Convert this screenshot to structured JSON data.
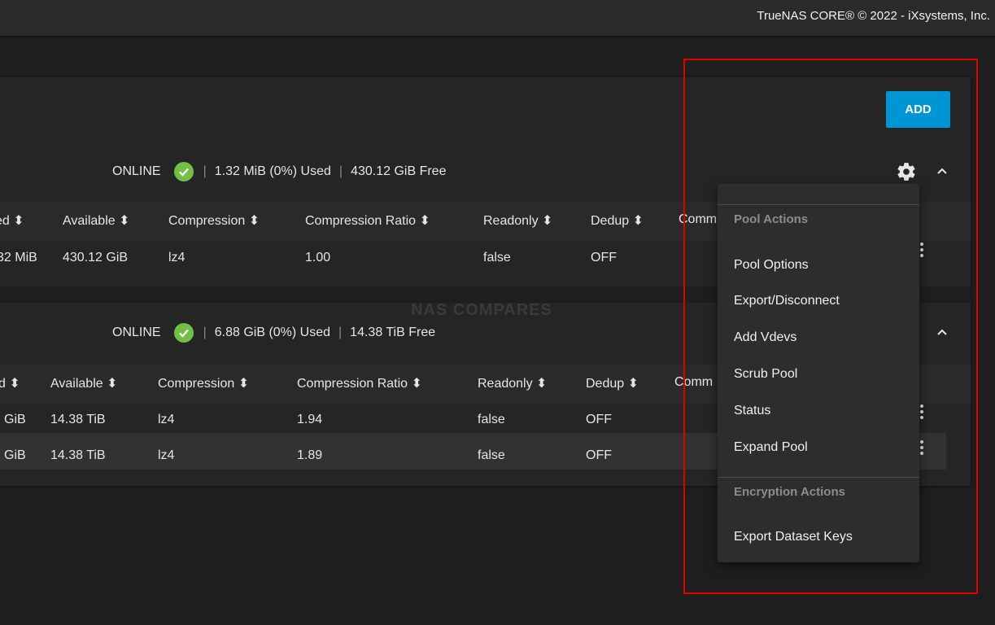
{
  "header": {
    "copyright": "TrueNAS CORE® © 2022 - iXsystems, Inc."
  },
  "toolbar": {
    "add_label": "ADD"
  },
  "watermark": "NAS COMPARES",
  "pools": [
    {
      "status": "ONLINE",
      "used": "1.32 MiB (0%) Used",
      "free": "430.12 GiB Free",
      "columns": [
        "ed ⬍",
        "Available ⬍",
        "Compression ⬍",
        "Compression Ratio ⬍",
        "Readonly ⬍",
        "Dedup ⬍",
        "Comm"
      ],
      "rows": [
        [
          "32 MiB",
          "430.12 GiB",
          "lz4",
          "1.00",
          "false",
          "OFF"
        ]
      ]
    },
    {
      "status": "ONLINE",
      "used": "6.88 GiB (0%) Used",
      "free": "14.38 TiB Free",
      "columns": [
        "d ⬍",
        "Available ⬍",
        "Compression ⬍",
        "Compression Ratio ⬍",
        "Readonly ⬍",
        "Dedup ⬍",
        "Comm"
      ],
      "rows": [
        [
          "GiB",
          "14.38 TiB",
          "lz4",
          "1.94",
          "false",
          "OFF"
        ],
        [
          "GiB",
          "14.38 TiB",
          "lz4",
          "1.89",
          "false",
          "OFF"
        ]
      ]
    }
  ],
  "menu": {
    "pool_actions_header": "Pool Actions",
    "pool_actions": [
      "Pool Options",
      "Export/Disconnect",
      "Add Vdevs",
      "Scrub Pool",
      "Status",
      "Expand Pool"
    ],
    "encryption_header": "Encryption Actions",
    "encryption_actions": [
      "Export Dataset Keys"
    ]
  },
  "colors": {
    "accent": "#0095d5",
    "online": "#71bf44",
    "highlight": "#e00000"
  }
}
